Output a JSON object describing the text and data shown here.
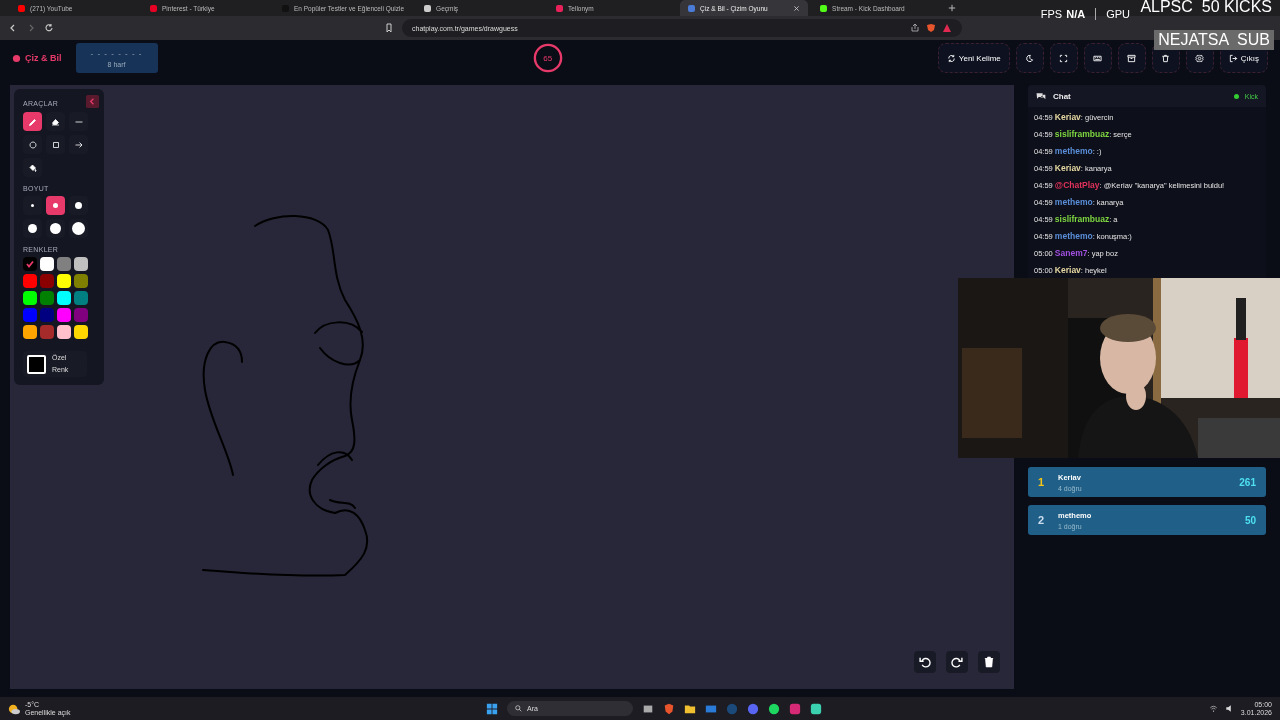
{
  "browser": {
    "tabs": [
      {
        "title": "(271) YouTube",
        "selected": false,
        "color": "#ff0000"
      },
      {
        "title": "Pinterest - Türkiye",
        "selected": false,
        "color": "#e60023"
      },
      {
        "title": "En Popüler Testler ve Eğlenceli Quizle",
        "selected": false,
        "color": "#111111"
      },
      {
        "title": "Geçmiş",
        "selected": false,
        "color": "#cccccc"
      },
      {
        "title": "Tellonym",
        "selected": false,
        "color": "#e8215a"
      },
      {
        "title": "Çiz & Bil - Çizim Oyunu",
        "selected": true,
        "color": "#4a7bd6"
      },
      {
        "title": "Stream - Kick Dashboard",
        "selected": false,
        "color": "#53fc18"
      }
    ],
    "url": "chatplay.com.tr/games/drawguess"
  },
  "perf_overlay": {
    "fps_label": "FPS",
    "fps_value": "N/A",
    "gpu_label": "GPU"
  },
  "stream_overlay": [
    "ALPSC  50 KICKS",
    "NEJATSA  SUB"
  ],
  "header": {
    "logo": "Çiz & Bil",
    "word_hint": "- - - - - - - -",
    "letters": "8 harf",
    "timer": "65",
    "buttons": [
      {
        "kind": "new_word",
        "label": "Yeni Kelime"
      },
      {
        "kind": "theme"
      },
      {
        "kind": "fullscreen"
      },
      {
        "kind": "keyboard"
      },
      {
        "kind": "archive"
      },
      {
        "kind": "trash"
      },
      {
        "kind": "settings"
      },
      {
        "kind": "exit",
        "label": "Çıkış"
      }
    ]
  },
  "tools": {
    "title": "ARAÇLAR",
    "items": [
      {
        "kind": "pen",
        "selected": true
      },
      {
        "kind": "eraser",
        "selected": false
      },
      {
        "kind": "line",
        "selected": false
      },
      {
        "kind": "circle",
        "selected": false
      },
      {
        "kind": "rect",
        "selected": false
      },
      {
        "kind": "arrow",
        "selected": false
      },
      {
        "kind": "fill",
        "selected": false
      }
    ],
    "size_title": "BOYUT",
    "sizes": [
      {
        "selected": false
      },
      {
        "selected": true
      },
      {
        "selected": false
      },
      {
        "selected": false
      },
      {
        "selected": false
      },
      {
        "selected": false
      }
    ],
    "color_title": "RENKLER",
    "colors": [
      {
        "color": "#000000",
        "selected": true
      },
      {
        "color": "#ffffff",
        "selected": false
      },
      {
        "color": "#808080",
        "selected": false
      },
      {
        "color": "#c0c0c0",
        "selected": false
      },
      {
        "color": "#ff0000",
        "selected": false
      },
      {
        "color": "#8b0000",
        "selected": false
      },
      {
        "color": "#ffff00",
        "selected": false
      },
      {
        "color": "#808000",
        "selected": false
      },
      {
        "color": "#00ff00",
        "selected": false
      },
      {
        "color": "#008000",
        "selected": false
      },
      {
        "color": "#00ffff",
        "selected": false
      },
      {
        "color": "#008080",
        "selected": false
      },
      {
        "color": "#0000ff",
        "selected": false
      },
      {
        "color": "#000080",
        "selected": false
      },
      {
        "color": "#ff00ff",
        "selected": false
      },
      {
        "color": "#800080",
        "selected": false
      },
      {
        "color": "#ffa500",
        "selected": false
      },
      {
        "color": "#a52a2a",
        "selected": false
      },
      {
        "color": "#ffc0cb",
        "selected": false
      },
      {
        "color": "#ffd700",
        "selected": false
      }
    ],
    "custom_color": "Özel Renk"
  },
  "chat": {
    "title": "Chat",
    "platform": "Kick",
    "messages": [
      {
        "time": "04:59",
        "user": "Keriav",
        "color": "#e6d8a2",
        "text": ": güvercin"
      },
      {
        "time": "04:59",
        "user": "sisliframbuaz",
        "color": "#7ed640",
        "text": ": serçe"
      },
      {
        "time": "04:59",
        "user": "methemo",
        "color": "#5a8ed8",
        "text": ": :)"
      },
      {
        "time": "04:59",
        "user": "Keriav",
        "color": "#e6d8a2",
        "text": ": kanarya"
      },
      {
        "time": "04:59",
        "user": "@ChatPlay",
        "color": "#e0325a",
        "text": ": @Keriav \"kanarya\" kelimesini buldu!"
      },
      {
        "time": "04:59",
        "user": "methemo",
        "color": "#5a8ed8",
        "text": ": kanarya"
      },
      {
        "time": "04:59",
        "user": "sisliframbuaz",
        "color": "#7ed640",
        "text": ": a"
      },
      {
        "time": "04:59",
        "user": "methemo",
        "color": "#5a8ed8",
        "text": ": konuşma:)"
      },
      {
        "time": "05:00",
        "user": "Sanem7",
        "color": "#a150e0",
        "text": ": yap boz"
      },
      {
        "time": "05:00",
        "user": "Keriav",
        "color": "#e6d8a2",
        "text": ": heykel"
      }
    ]
  },
  "leaderboard": [
    {
      "rank": "1",
      "name": "Keriav",
      "detail": "4 doğru",
      "score": "261"
    },
    {
      "rank": "2",
      "name": "methemo",
      "detail": "1 doğru",
      "score": "50"
    }
  ],
  "taskbar": {
    "weather_temp": "-5°C",
    "weather_text": "Genellikle açık",
    "search": "Ara",
    "time": "05:00",
    "date": "3.01.2026"
  }
}
